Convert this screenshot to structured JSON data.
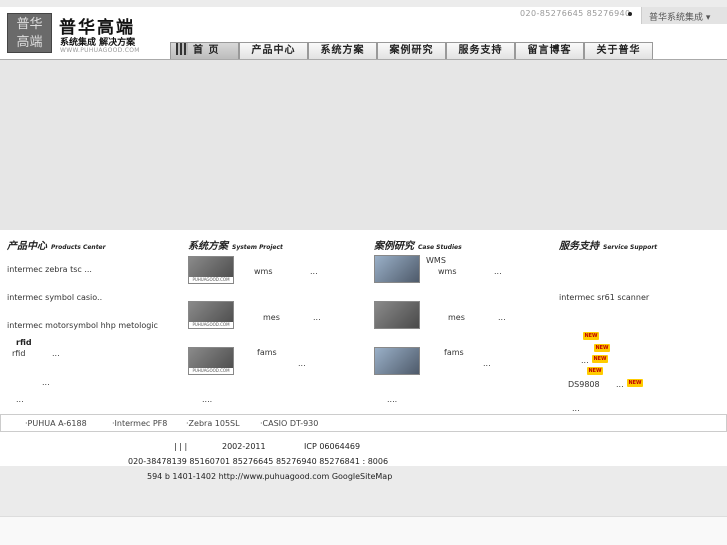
{
  "header": {
    "logo_text": "普华\n高端",
    "title": "普华高端",
    "subtitle": "系统集成 解决方案",
    "url": "WWW.PUHUAGOOD.COM",
    "phone": "020-85276645 85276940",
    "site_select": "普华系统集成 ▾"
  },
  "nav": [
    {
      "label": "首 页"
    },
    {
      "label": "产品中心"
    },
    {
      "label": "系统方案"
    },
    {
      "label": "案例研究"
    },
    {
      "label": "服务支持"
    },
    {
      "label": "留言博客"
    },
    {
      "label": "关于普华"
    }
  ],
  "sections": {
    "products": {
      "title": "产品中心",
      "en": "Products Center",
      "items": [
        "intermec zebra tsc ...",
        "intermec symbol casio..",
        "intermec motorsymbol hhp metologic"
      ],
      "rfid_title": "rfid",
      "rfid_item": "rfid",
      "rfid_more": "...",
      "more1": "...",
      "more2": "..."
    },
    "solutions": {
      "title": "系统方案",
      "en": "System Project",
      "items": [
        {
          "label": "wms",
          "more": "..."
        },
        {
          "label": "mes",
          "more": "..."
        },
        {
          "label": "fams",
          "more": "..."
        }
      ],
      "more": "...."
    },
    "cases": {
      "title": "案例研究",
      "en": "Case Studies",
      "heading": "WMS",
      "items": [
        {
          "label": "wms",
          "more": "..."
        },
        {
          "label": "mes",
          "more": "..."
        },
        {
          "label": "fams",
          "more": "..."
        }
      ],
      "more": "...."
    },
    "support": {
      "title": "服务支持",
      "en": "Service Support",
      "item1": "intermec sr61 scanner",
      "dots": "...",
      "ds": "DS9808",
      "ds_more": "...",
      "more": "...",
      "new_label": "NEW"
    }
  },
  "thumb_label": "PUHUAGOOD.COM",
  "products_bar": [
    "·PUHUA A-6188",
    "·Intermec PF8",
    "·Zebra 105SL",
    "·CASIO DT-930"
  ],
  "footer": {
    "line1_sep": "|      |      |",
    "copyright": "2002-2011",
    "icp": "ICP 06064469",
    "phones": "020-38478139 85160701 85276645 85276940 85276841  :      8006",
    "address": "594    b  1401-1402   http://www.puhuagood.com GoogleSiteMap"
  }
}
